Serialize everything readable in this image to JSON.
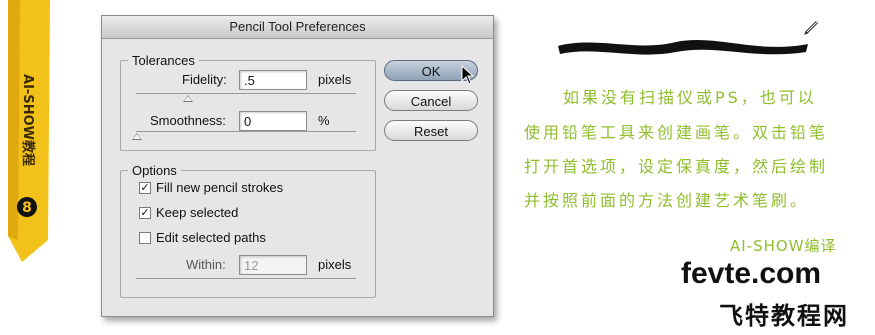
{
  "dialog": {
    "title": "Pencil Tool Preferences",
    "tolerances": {
      "legend": "Tolerances",
      "fidelity_label": "Fidelity:",
      "fidelity_value": ".5",
      "fidelity_unit": "pixels",
      "smoothness_label": "Smoothness:",
      "smoothness_value": "0",
      "smoothness_unit": "%"
    },
    "options": {
      "legend": "Options",
      "fill_label": "Fill new pencil strokes",
      "fill_checked": true,
      "keep_label": "Keep selected",
      "keep_checked": true,
      "edit_label": "Edit selected paths",
      "edit_checked": false,
      "within_label": "Within:",
      "within_value": "12",
      "within_unit": "pixels"
    },
    "buttons": {
      "ok": "OK",
      "cancel": "Cancel",
      "reset": "Reset"
    }
  },
  "ribbon": {
    "text": "AI-SHOW教程",
    "number": "8"
  },
  "note": {
    "line1": "如果没有扫描仪或PS，也可以",
    "line2": "使用铅笔工具来创建画笔。双击铅笔",
    "line3": "打开首选项，设定保真度，然后绘制",
    "line4": "并按照前面的方法创建艺术笔刷。",
    "signature": "AI-SHOW编译"
  },
  "watermark": {
    "site": "fevte.com",
    "name": "飞特教程网"
  },
  "colors": {
    "accent_green": "#8fbf2e",
    "ribbon_yellow": "#f2c21a"
  }
}
